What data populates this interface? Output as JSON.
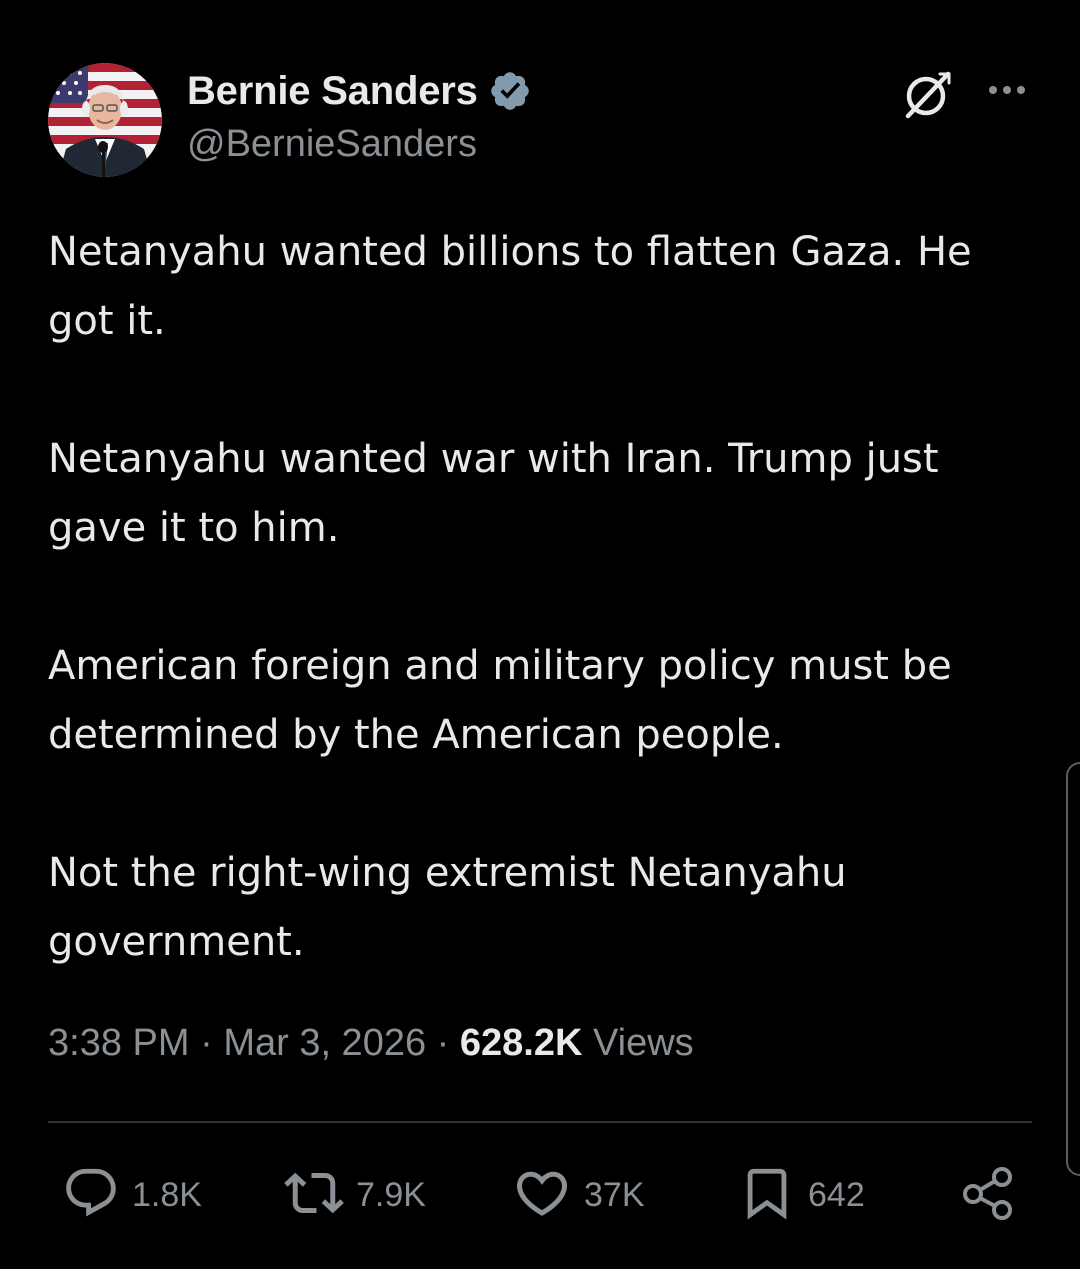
{
  "author": {
    "display_name": "Bernie Sanders",
    "handle": "@BernieSanders",
    "verified": true,
    "verified_icon": "verified-badge-icon",
    "avatar_icon": "profile-avatar"
  },
  "header_actions": {
    "grok_icon": "grok-icon",
    "more_icon": "more-dots-icon"
  },
  "tweet": {
    "paragraphs": [
      "Netanyahu wanted billions to flatten Gaza. He got it.",
      "Netanyahu wanted war with Iran. Trump just gave it to him.",
      "American foreign and military policy must be determined by the American people.",
      "Not the right-wing extremist Netanyahu government."
    ]
  },
  "meta": {
    "time": "3:38 PM",
    "separator": "·",
    "date": "Mar 3, 2026",
    "views_count": "628.2K",
    "views_label": "Views"
  },
  "actions": {
    "reply": {
      "icon": "reply-icon",
      "count": "1.8K"
    },
    "repost": {
      "icon": "repost-icon",
      "count": "7.9K"
    },
    "like": {
      "icon": "heart-icon",
      "count": "37K"
    },
    "bookmark": {
      "icon": "bookmark-icon",
      "count": "642"
    },
    "share": {
      "icon": "share-icon"
    }
  },
  "colors": {
    "background": "#000000",
    "text_primary": "#e7e9ea",
    "text_secondary": "#8b9095",
    "divider": "#2f3336",
    "verified_badge": "#829aab"
  }
}
